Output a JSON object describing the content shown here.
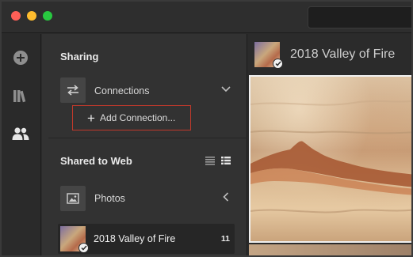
{
  "window": {
    "traffic_lights": [
      "close",
      "minimize",
      "zoom"
    ]
  },
  "rail": {
    "icons": [
      "add-icon",
      "library-icon",
      "people-icon"
    ]
  },
  "sharing": {
    "title": "Sharing",
    "connections": {
      "label": "Connections",
      "icon": "connections-arrows-icon",
      "state": "expanded"
    },
    "add_connection": {
      "label": "Add Connection..."
    }
  },
  "shared_to_web": {
    "title": "Shared to Web",
    "view_modes": [
      "list-view-icon",
      "detail-list-view-icon"
    ],
    "photos": {
      "label": "Photos",
      "icon": "image-icon",
      "state": "collapsed"
    },
    "albums": [
      {
        "name": "2018 Valley of Fire",
        "count": "11",
        "shared": true
      }
    ]
  },
  "main": {
    "album_title": "2018 Valley of Fire"
  },
  "colors": {
    "highlight_box": "#c0392b",
    "panel_bg": "#323232",
    "main_bg": "#2b2b2b"
  }
}
